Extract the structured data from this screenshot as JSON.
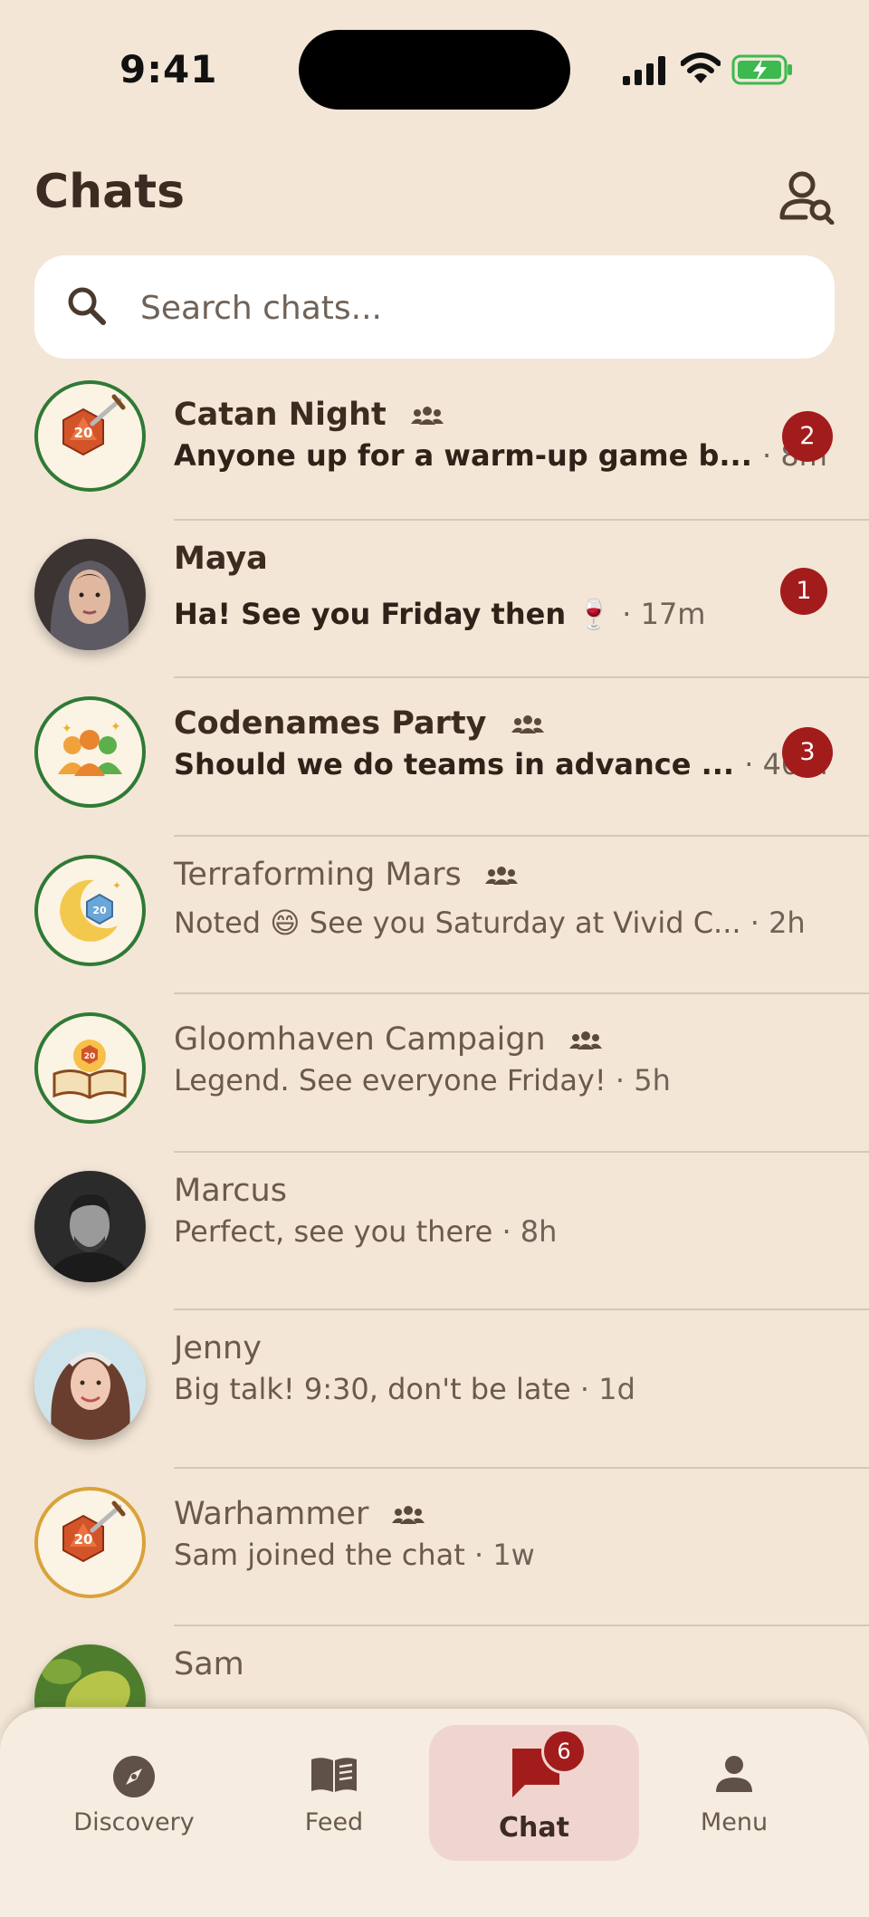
{
  "status_bar": {
    "time": "9:41"
  },
  "header": {
    "title": "Chats"
  },
  "search": {
    "placeholder": "Search chats..."
  },
  "colors": {
    "accent": "#a31c1c",
    "ring_green": "#2f7a35",
    "ring_gold": "#d9a23a",
    "background": "#f3e6d6"
  },
  "chats": [
    {
      "name": "Catan Night",
      "group": true,
      "avatar_icon": "d20-dice-sword-icon",
      "preview": "Anyone up for a warm-up game b...",
      "time": "· 8m",
      "unread": "2"
    },
    {
      "name": "Maya",
      "group": false,
      "avatar_icon": "user-photo",
      "preview": "Ha! See you Friday then 🍷",
      "time": "· 17m",
      "unread": "1"
    },
    {
      "name": "Codenames Party",
      "group": true,
      "avatar_icon": "team-people-icon",
      "preview": "Should we do teams in advance ...",
      "time": "· 40m",
      "unread": "3"
    },
    {
      "name": "Terraforming Mars",
      "group": true,
      "avatar_icon": "moon-dice-icon",
      "preview": "Noted 😄  See you Saturday at Vivid C...",
      "time": "· 2h",
      "unread": ""
    },
    {
      "name": "Gloomhaven Campaign",
      "group": true,
      "avatar_icon": "open-book-dice-icon",
      "preview": "Legend. See everyone Friday!",
      "time": "· 5h",
      "unread": ""
    },
    {
      "name": "Marcus",
      "group": false,
      "avatar_icon": "user-photo",
      "preview": "Perfect, see you there",
      "time": "· 8h",
      "unread": ""
    },
    {
      "name": "Jenny",
      "group": false,
      "avatar_icon": "user-photo",
      "preview": "Big talk! 9:30, don't be late",
      "time": "· 1d",
      "unread": ""
    },
    {
      "name": "Warhammer",
      "group": true,
      "avatar_icon": "d20-dice-sword-icon",
      "preview": "Sam joined the chat",
      "time": "· 1w",
      "unread": ""
    },
    {
      "name": "Sam",
      "group": false,
      "avatar_icon": "user-photo",
      "preview": "",
      "time": "",
      "unread": ""
    }
  ],
  "nav": {
    "discovery": "Discovery",
    "feed": "Feed",
    "chat": "Chat",
    "chat_badge": "6",
    "menu": "Menu"
  }
}
